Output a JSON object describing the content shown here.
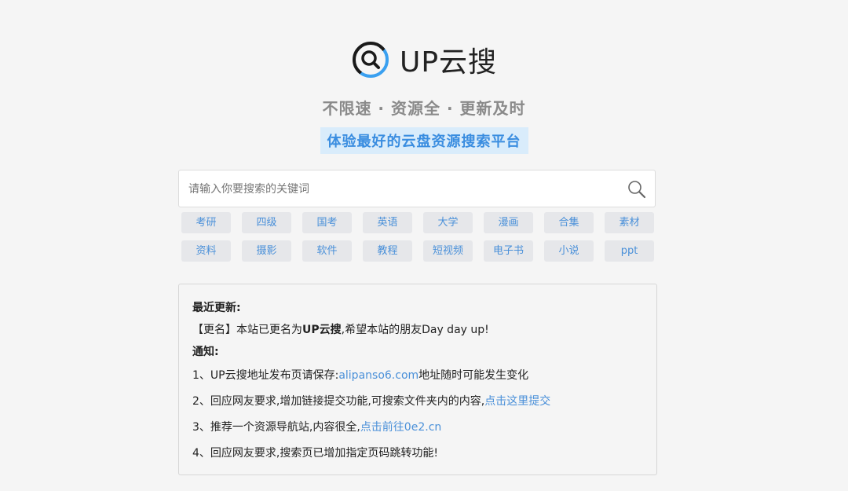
{
  "brand": {
    "name": "UP云搜",
    "accent": "#3a8de0",
    "logo_icon": "search-icon"
  },
  "slogan": "不限速 · 资源全 · 更新及时",
  "tagline": "体验最好的云盘资源搜索平台",
  "search": {
    "placeholder": "请输入你要搜索的关键词",
    "value": "",
    "button_icon": "search-icon"
  },
  "tags": [
    "考研",
    "四级",
    "国考",
    "英语",
    "大学",
    "漫画",
    "合集",
    "素材",
    "资料",
    "摄影",
    "软件",
    "教程",
    "短视频",
    "电子书",
    "小说",
    "ppt"
  ],
  "notice": {
    "title": "最近更新:",
    "rename_prefix": "【更名】本站已更名为",
    "rename_name": "UP云搜",
    "rename_suffix": ",希望本站的朋友Day day up!",
    "notify_title": "通知:",
    "item1_prefix": "1、UP云搜地址发布页请保存:",
    "item1_link": "alipanso6.com",
    "item1_suffix": "地址随时可能发生变化",
    "item2_prefix": "2、回应网友要求,增加链接提交功能,可搜索文件夹内的内容,",
    "item2_link": "点击这里提交",
    "item3_prefix": "3、推荐一个资源导航站,内容很全,",
    "item3_link": "点击前往0e2.cn",
    "item4": "4、回应网友要求,搜索页已增加指定页码跳转功能!"
  }
}
